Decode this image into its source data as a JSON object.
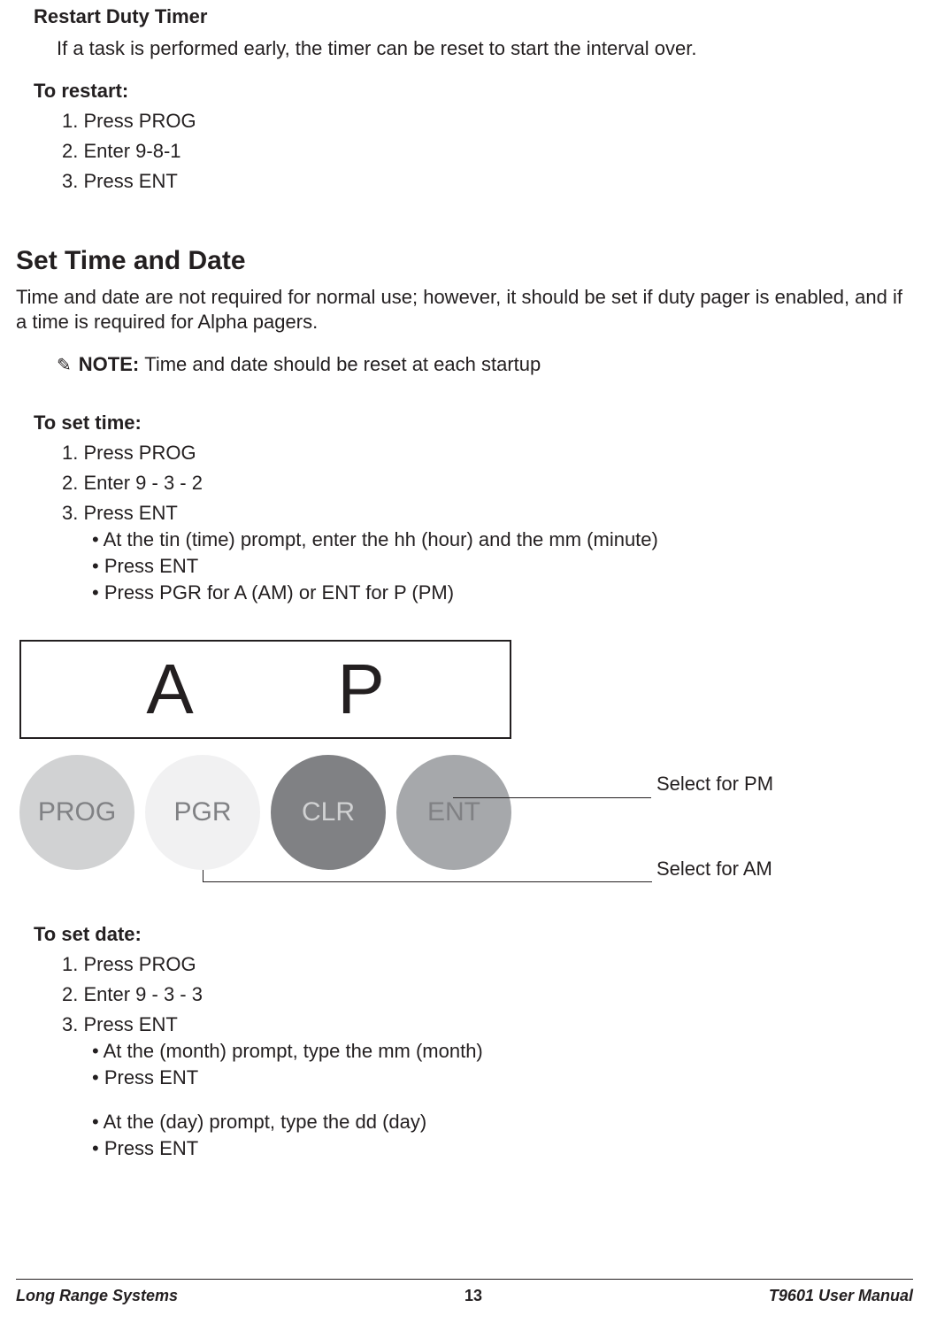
{
  "section_restart": {
    "title": "Restart Duty Timer",
    "desc": "If a task is performed early, the timer can be reset to start the interval over.",
    "to_label": "To restart:",
    "steps": [
      "1. Press PROG",
      "2. Enter 9-8-1",
      "3. Press ENT"
    ]
  },
  "section_settime": {
    "title": "Set Time and Date",
    "intro": "Time and date are not required for normal use; however, it should be set if duty pager is enabled, and if a time is required for Alpha pagers.",
    "note_label": "NOTE:",
    "note_text": "Time and date should be reset at each startup",
    "time_label": "To set time:",
    "time_steps": [
      "1. Press PROG",
      "2. Enter 9 - 3 - 2",
      "3. Press ENT"
    ],
    "time_bullets": [
      "• At the tin (time) prompt, enter the hh (hour) and the mm (minute)",
      "• Press ENT",
      "• Press PGR for A (AM) or ENT for P (PM)"
    ],
    "date_label": "To set date:",
    "date_steps": [
      "1. Press PROG",
      "2. Enter 9 - 3 - 3",
      "3. Press ENT"
    ],
    "date_bullets_a": [
      "• At the (month) prompt, type the mm (month)",
      "• Press ENT"
    ],
    "date_bullets_b": [
      "• At the (day) prompt, type the dd (day)",
      "• Press ENT"
    ]
  },
  "diagram": {
    "display": {
      "left": "A",
      "right": "P"
    },
    "buttons": {
      "prog": "PROG",
      "pgr": "PGR",
      "clr": "CLR",
      "ent": "ENT"
    },
    "label_pm": "Select for PM",
    "label_am": "Select for AM"
  },
  "footer": {
    "left": "Long Range Systems",
    "page": "13",
    "right": "T9601 User Manual"
  }
}
